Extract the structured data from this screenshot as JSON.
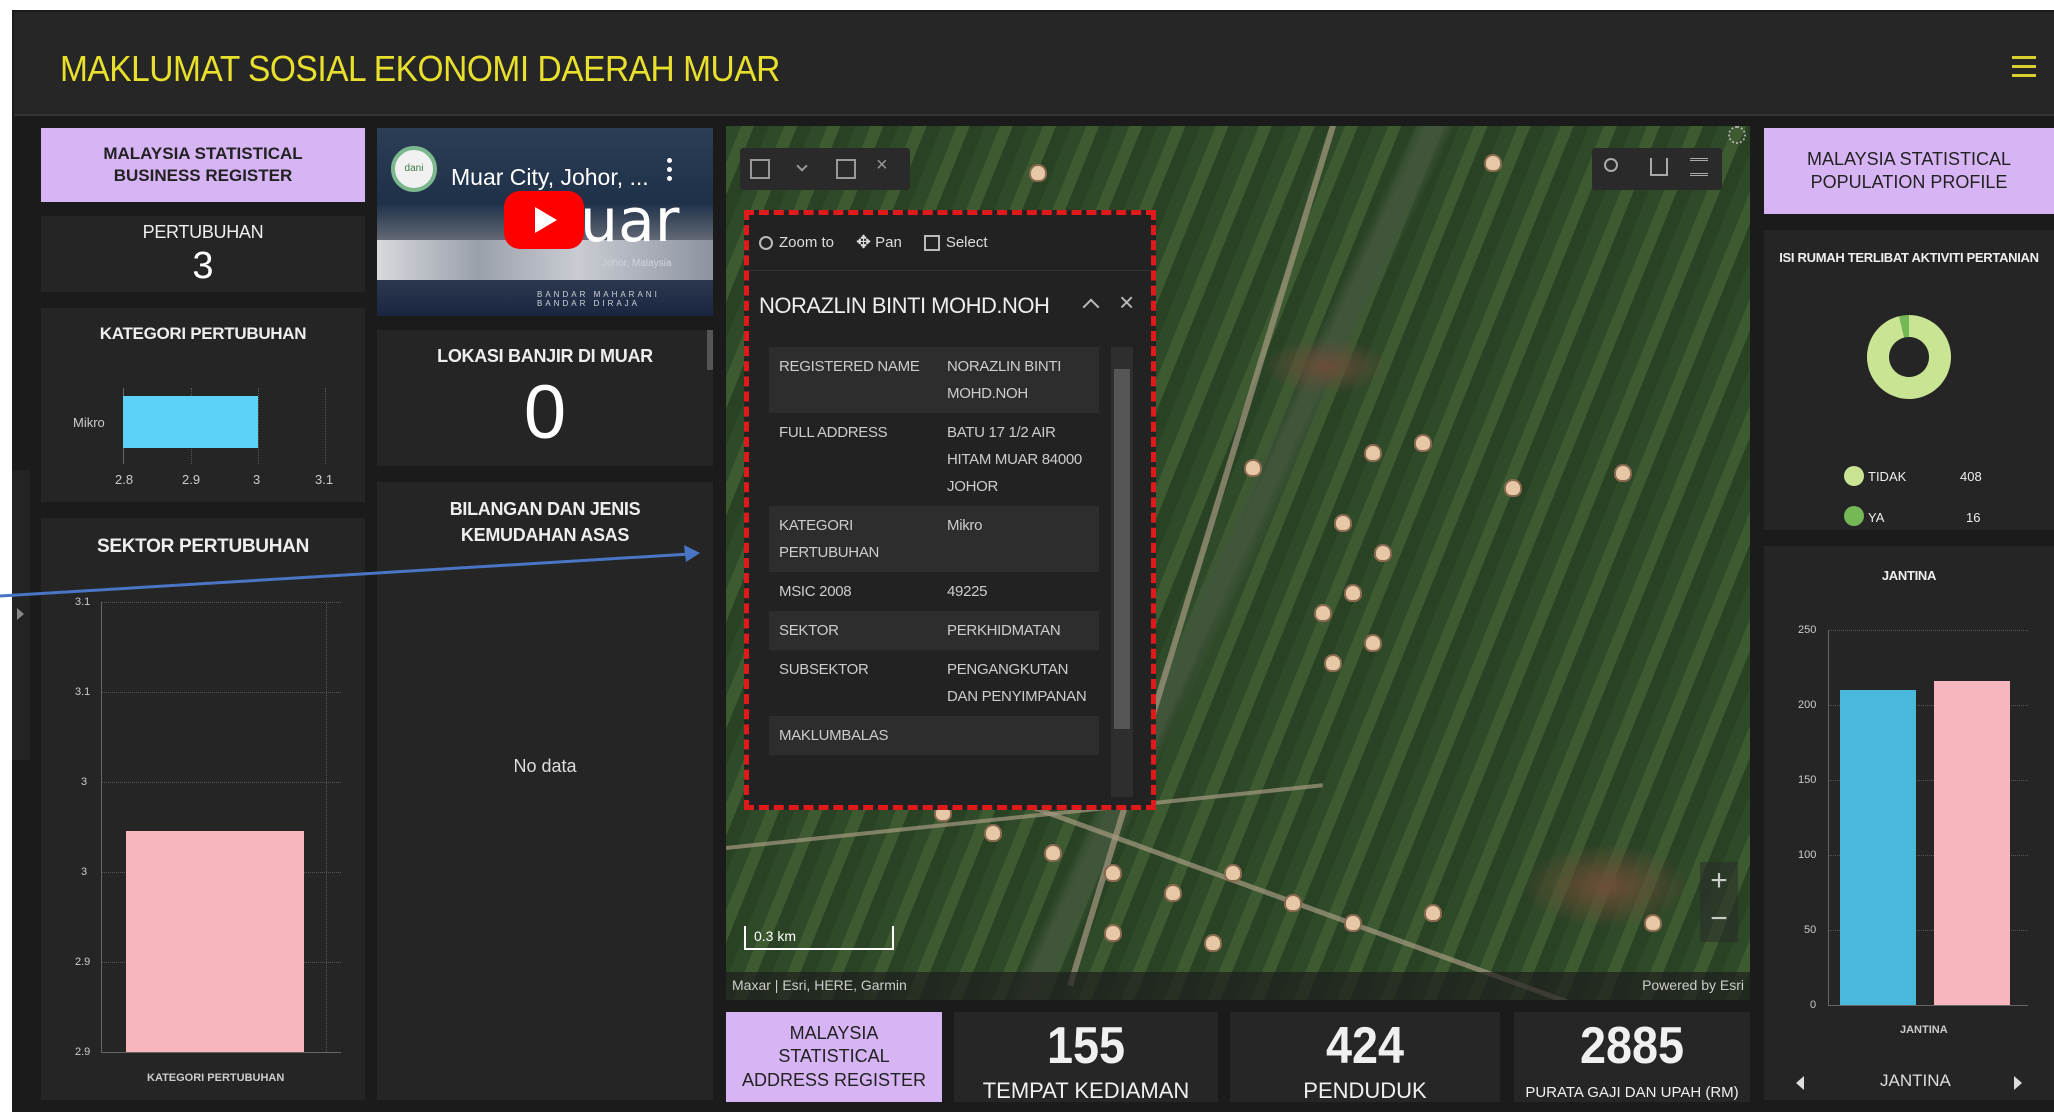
{
  "header": {
    "title": "MAKLUMAT SOSIAL EKONOMI DAERAH MUAR",
    "menu_icon": "hamburger-icon"
  },
  "colors": {
    "title": "#e8e02c",
    "lavender": "#d7b4f4",
    "bar_cyan": "#5cd2f7",
    "bar_pink": "#f7b6bd",
    "donut": "#c9e492",
    "highlight": "#e0191b",
    "bar_blue": "#4ab7dc"
  },
  "business_register": {
    "title": "MALAYSIA STATISTICAL BUSINESS REGISTER",
    "pertubuhan_label": "PERTUBUHAN",
    "pertubuhan_value": "3",
    "kategori": {
      "title": "KATEGORI PERTUBUHAN",
      "category": "Mikro",
      "ticks": [
        "2.8",
        "2.9",
        "3",
        "3.1"
      ]
    },
    "sektor": {
      "title": "SEKTOR PERTUBUHAN",
      "ticks": [
        "3.1",
        "3.1",
        "3",
        "3",
        "2.9",
        "2.9"
      ],
      "xlabel": "KATEGORI PERTUBUHAN"
    }
  },
  "video": {
    "title": "Muar City, Johor, ...",
    "brand_text": "uar",
    "channel_badge": "dani",
    "subtitle": "Johor, Malaysia",
    "subtitle2": "BANDAR MAHARANI BANDAR DIRAJA"
  },
  "banjir": {
    "title": "LOKASI BANJIR DI MUAR",
    "value": "0"
  },
  "kemudahan": {
    "title": "BILANGAN DAN JENIS KEMUDAHAN ASAS",
    "empty": "No data"
  },
  "map": {
    "scale": "0.3 km",
    "attribution": "Maxar | Esri, HERE, Garmin",
    "powered": "Powered by Esri",
    "zoom_in": "+",
    "zoom_out": "−",
    "tools": [
      "Zoom to",
      "Pan",
      "Select"
    ]
  },
  "popup": {
    "title": "NORAZLIN BINTI MOHD.NOH",
    "rows": [
      {
        "k": "REGISTERED NAME",
        "v": "NORAZLIN BINTI MOHD.NOH"
      },
      {
        "k": "FULL ADDRESS",
        "v": "BATU 17 1/2 AIR HITAM MUAR 84000 JOHOR"
      },
      {
        "k": "KATEGORI PERTUBUHAN",
        "v": "Mikro"
      },
      {
        "k": "MSIC 2008",
        "v": "49225"
      },
      {
        "k": "SEKTOR",
        "v": "PERKHIDMATAN"
      },
      {
        "k": "SUBSEKTOR",
        "v": "PENGANGKUTAN DAN PENYIMPANAN"
      },
      {
        "k": "MAKLUMBALAS",
        "v": ""
      }
    ]
  },
  "address_register": {
    "title": "MALAYSIA STATISTICAL ADDRESS REGISTER"
  },
  "kpis": [
    {
      "value": "155",
      "label": "TEMPAT KEDIAMAN"
    },
    {
      "value": "424",
      "label": "PENDUDUK"
    },
    {
      "value": "2885",
      "label": "PURATA GAJI DAN UPAH (RM)"
    }
  ],
  "population": {
    "title": "MALAYSIA STATISTICAL POPULATION PROFILE",
    "donut_title": "ISI RUMAH TERLIBAT AKTIVITI PERTANIAN",
    "legend": [
      {
        "label": "TIDAK",
        "value": "408"
      },
      {
        "label": "YA",
        "value": "16"
      }
    ],
    "jantina": {
      "title": "JANTINA",
      "xlabel": "JANTINA",
      "ticks": [
        "250",
        "200",
        "150",
        "100",
        "50",
        "0"
      ],
      "nav_label": "JANTINA"
    }
  },
  "chart_data": [
    {
      "type": "bar",
      "title": "KATEGORI PERTUBUHAN",
      "orientation": "horizontal",
      "categories": [
        "Mikro"
      ],
      "values": [
        3
      ],
      "xlim": [
        2.8,
        3.1
      ]
    },
    {
      "type": "bar",
      "title": "SEKTOR PERTUBUHAN",
      "categories": [
        "KATEGORI PERTUBUHAN"
      ],
      "values": [
        3
      ],
      "ylim": [
        2.9,
        3.1
      ]
    },
    {
      "type": "pie",
      "title": "ISI RUMAH TERLIBAT AKTIVITI PERTANIAN",
      "categories": [
        "TIDAK",
        "YA"
      ],
      "values": [
        408,
        16
      ]
    },
    {
      "type": "bar",
      "title": "JANTINA",
      "xlabel": "JANTINA",
      "series": [
        {
          "values": [
            210
          ]
        },
        {
          "values": [
            216
          ]
        }
      ],
      "ylim": [
        0,
        250
      ]
    }
  ]
}
